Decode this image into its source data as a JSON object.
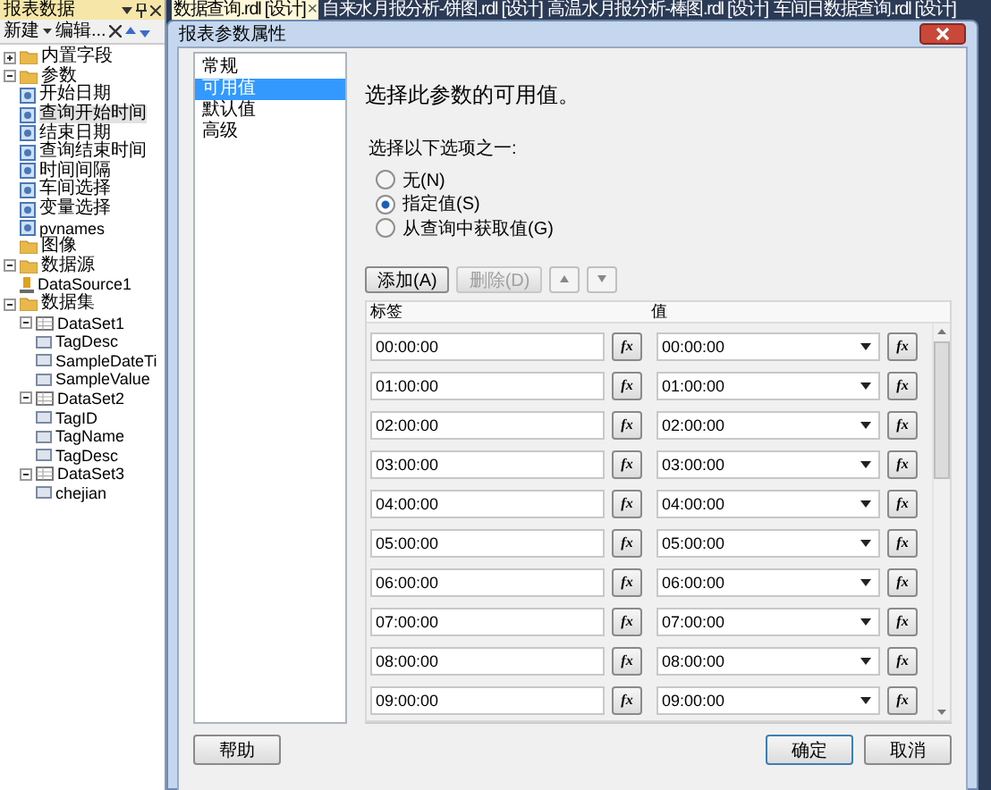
{
  "side_panel": {
    "title": "报表数据",
    "toolbar": {
      "new_label": "新建",
      "edit_label": "编辑..."
    },
    "tree": [
      {
        "label": "内置字段",
        "kind": "folder",
        "expanded": false,
        "selected": false
      },
      {
        "label": "参数",
        "kind": "folder",
        "expanded": true,
        "selected": false,
        "children": [
          {
            "label": "开始日期",
            "kind": "param",
            "selected": false
          },
          {
            "label": "查询开始时间",
            "kind": "param",
            "selected": true
          },
          {
            "label": "结束日期",
            "kind": "param",
            "selected": false
          },
          {
            "label": "查询结束时间",
            "kind": "param",
            "selected": false
          },
          {
            "label": "时间间隔",
            "kind": "param",
            "selected": false
          },
          {
            "label": "车间选择",
            "kind": "param",
            "selected": false
          },
          {
            "label": "变量选择",
            "kind": "param",
            "selected": false
          },
          {
            "label": "pvnames",
            "kind": "param",
            "selected": false
          }
        ]
      },
      {
        "label": "图像",
        "kind": "folder",
        "selected": false
      },
      {
        "label": "数据源",
        "kind": "folder",
        "expanded": true,
        "selected": false,
        "children": [
          {
            "label": "DataSource1",
            "kind": "datasource",
            "selected": false
          }
        ]
      },
      {
        "label": "数据集",
        "kind": "folder",
        "expanded": true,
        "selected": false,
        "children": [
          {
            "label": "DataSet1",
            "kind": "dataset",
            "expanded": true,
            "selected": false,
            "children": [
              {
                "label": "TagDesc",
                "kind": "field",
                "selected": false
              },
              {
                "label": "SampleDateTi",
                "kind": "field",
                "selected": false
              },
              {
                "label": "SampleValue",
                "kind": "field",
                "selected": false
              }
            ]
          },
          {
            "label": "DataSet2",
            "kind": "dataset",
            "expanded": true,
            "selected": false,
            "children": [
              {
                "label": "TagID",
                "kind": "field",
                "selected": false
              },
              {
                "label": "TagName",
                "kind": "field",
                "selected": false
              },
              {
                "label": "TagDesc",
                "kind": "field",
                "selected": false
              }
            ]
          },
          {
            "label": "DataSet3",
            "kind": "dataset",
            "expanded": true,
            "selected": false,
            "children": [
              {
                "label": "chejian",
                "kind": "field",
                "selected": false
              }
            ]
          }
        ]
      }
    ]
  },
  "tabs": [
    {
      "label": "数据查询.rdl [设计]",
      "selected": true,
      "close": "×"
    },
    {
      "label": "自来水月报分析-饼图.rdl [设计]",
      "selected": false
    },
    {
      "label": "高温水月报分析-棒图.rdl [设计]",
      "selected": false
    },
    {
      "label": "车间日数据查询.rdl [设计]",
      "selected": false
    }
  ],
  "dialog": {
    "title": "报表参数属性",
    "nav": [
      {
        "label": "常规",
        "selected": false
      },
      {
        "label": "可用值",
        "selected": true
      },
      {
        "label": "默认值",
        "selected": false
      },
      {
        "label": "高级",
        "selected": false
      }
    ],
    "heading": "选择此参数的可用值。",
    "options_label": "选择以下选项之一:",
    "options": [
      {
        "label": "无(N)",
        "selected": false
      },
      {
        "label": "指定值(S)",
        "selected": true
      },
      {
        "label": "从查询中获取值(G)",
        "selected": false
      }
    ],
    "buttons": [
      {
        "label": "添加(A)",
        "disabled": false
      },
      {
        "label": "删除(D)",
        "disabled": true
      }
    ],
    "table": {
      "columns": [
        "标签",
        "值"
      ],
      "rows": [
        {
          "label": "00:00:00",
          "label_fx": "fx",
          "value": "00:00:00",
          "value_fx": "fx"
        },
        {
          "label": "01:00:00",
          "label_fx": "fx",
          "value": "01:00:00",
          "value_fx": "fx"
        },
        {
          "label": "02:00:00",
          "label_fx": "fx",
          "value": "02:00:00",
          "value_fx": "fx"
        },
        {
          "label": "03:00:00",
          "label_fx": "fx",
          "value": "03:00:00",
          "value_fx": "fx"
        },
        {
          "label": "04:00:00",
          "label_fx": "fx",
          "value": "04:00:00",
          "value_fx": "fx"
        },
        {
          "label": "05:00:00",
          "label_fx": "fx",
          "value": "05:00:00",
          "value_fx": "fx"
        },
        {
          "label": "06:00:00",
          "label_fx": "fx",
          "value": "06:00:00",
          "value_fx": "fx"
        },
        {
          "label": "07:00:00",
          "label_fx": "fx",
          "value": "07:00:00",
          "value_fx": "fx"
        },
        {
          "label": "08:00:00",
          "label_fx": "fx",
          "value": "08:00:00",
          "value_fx": "fx"
        },
        {
          "label": "09:00:00",
          "label_fx": "fx",
          "value": "09:00:00",
          "value_fx": "fx"
        }
      ]
    },
    "help": "帮助",
    "ok": "确定",
    "cancel": "取消"
  }
}
